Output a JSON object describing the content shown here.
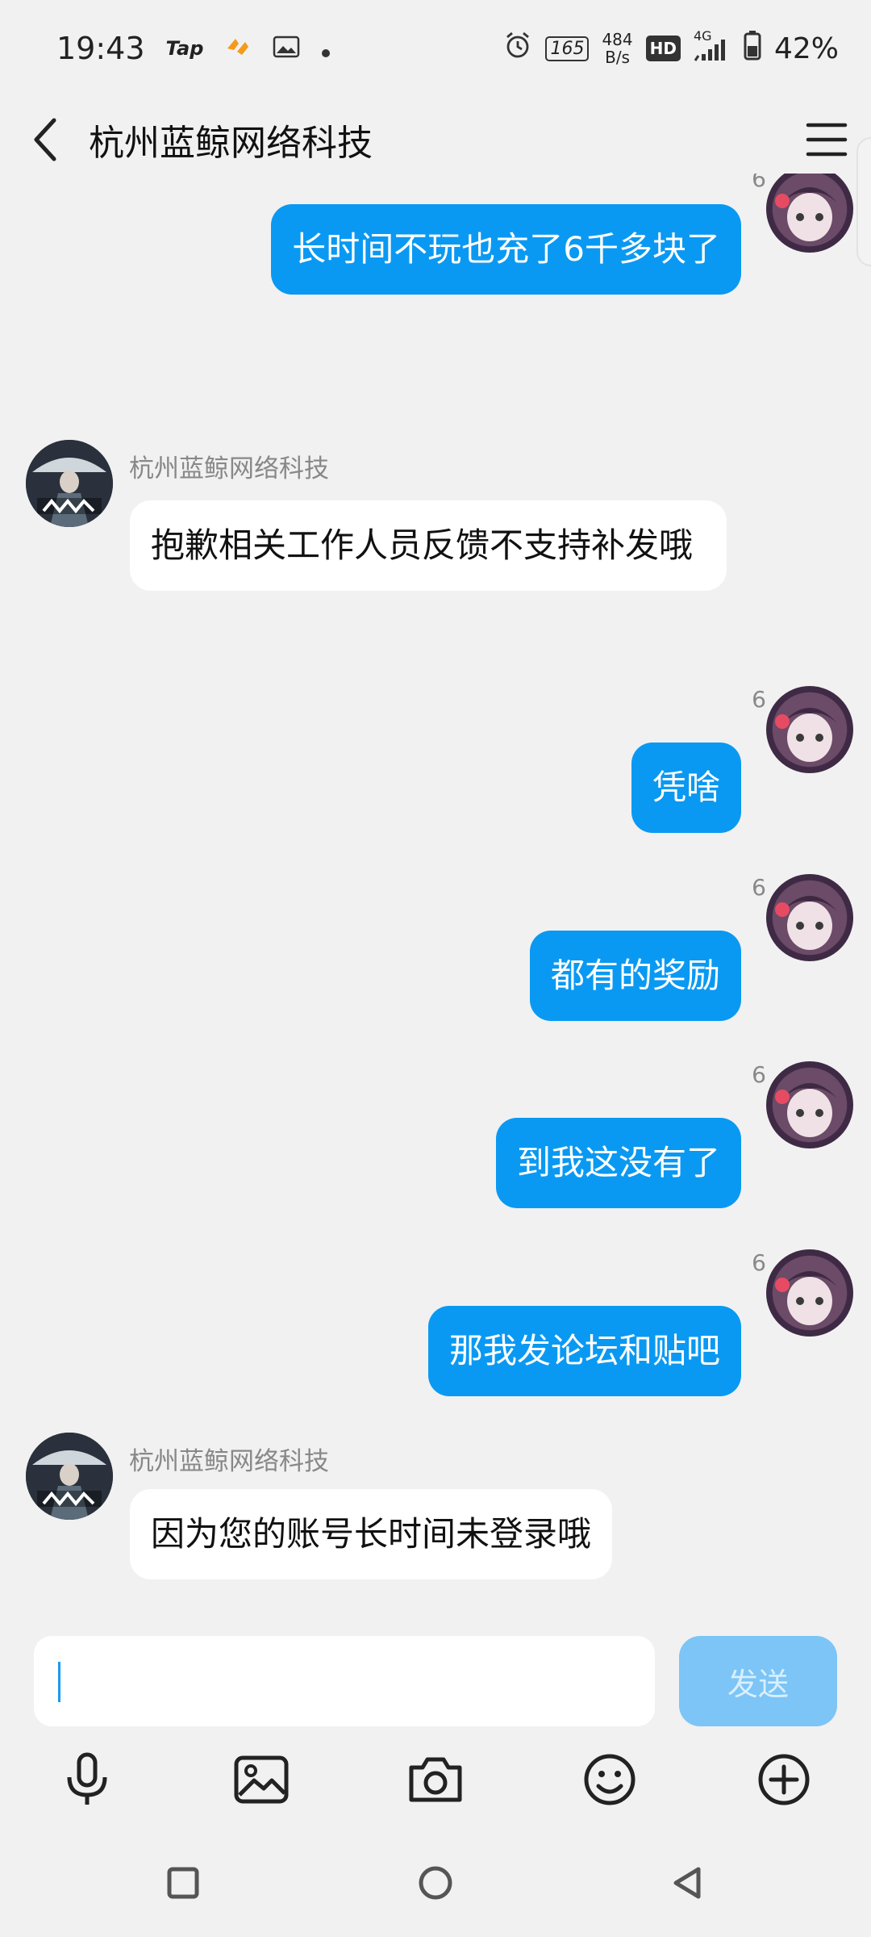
{
  "status_bar": {
    "time": "19:43",
    "tap": "Tap",
    "refresh": "165",
    "speed_value": "484",
    "speed_unit": "B/s",
    "hd": "HD",
    "net": "4G",
    "battery": "42%"
  },
  "header": {
    "title": "杭州蓝鲸网络科技"
  },
  "messages": [
    {
      "side": "me",
      "sender": "6",
      "text": "长时间不玩也充了6千多块了"
    },
    {
      "side": "them",
      "sender": "杭州蓝鲸网络科技",
      "text": "抱歉相关工作人员反馈不支持补发哦"
    },
    {
      "side": "me",
      "sender": "6",
      "text": "凭啥"
    },
    {
      "side": "me",
      "sender": "6",
      "text": "都有的奖励"
    },
    {
      "side": "me",
      "sender": "6",
      "text": "到我这没有了"
    },
    {
      "side": "me",
      "sender": "6",
      "text": "那我发论坛和贴吧"
    },
    {
      "side": "them",
      "sender": "杭州蓝鲸网络科技",
      "text": "因为您的账号长时间未登录哦"
    }
  ],
  "composer": {
    "input_value": "",
    "send_label": "发送"
  },
  "icons": {
    "accent": "#0a99f2",
    "bubble_me": "#0a99f2",
    "bubble_them": "#ffffff",
    "background": "#f1f1f1",
    "send_disabled": "#7cc5f6"
  }
}
